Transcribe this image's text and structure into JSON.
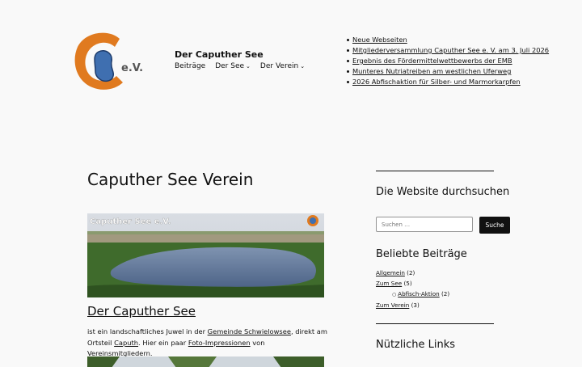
{
  "site": {
    "title": "Der Caputher See",
    "logo_text": "e.V."
  },
  "nav": [
    {
      "label": "Beiträge",
      "has_dropdown": false
    },
    {
      "label": "Der See",
      "has_dropdown": true
    },
    {
      "label": "Der Verein",
      "has_dropdown": true
    }
  ],
  "recent_posts": [
    "Neue Webseiten",
    "Mitgliederversammlung Caputher See e. V. am 3. Juli 2026",
    "Ergebnis des Fördermittelwettbewerbs der EMB",
    "Munteres Nutriatreiben am westlichen Uferweg",
    "2026 Abfischaktion für Silber- und Marmorkarpfen"
  ],
  "page_title": "Caputher See Verein",
  "post": {
    "image_caption": "Caputher See e.V.",
    "title": "Der Caputher See",
    "excerpt_1": "ist ein landschaftliches Juwel in der ",
    "link_gemeinde": "Gemeinde Schwielowsee",
    "excerpt_2": ", direkt am Ortsteil ",
    "link_caputh": "Caputh",
    "excerpt_3": ". Hier ein paar ",
    "link_foto": "Foto-Impressionen",
    "excerpt_4": " von Vereinsmitgliedern."
  },
  "sidebar": {
    "search_title": "Die Website durchsuchen",
    "search_placeholder": "Suchen …",
    "search_button": "Suche",
    "popular_title": "Beliebte Beiträge",
    "categories": [
      {
        "label": "Allgemein",
        "count": "(2)"
      },
      {
        "label": "Zum See",
        "count": "(5)"
      },
      {
        "label": "Abfisch-Aktion",
        "count": "(2)"
      },
      {
        "label": "Zum Verein",
        "count": "(3)"
      }
    ],
    "links_title": "Nützliche Links"
  },
  "colors": {
    "accent": "#e07a1f",
    "logo_blue": "#3f6fb0",
    "text": "#111111",
    "background": "#f9f9f9"
  },
  "icons": {
    "dropdown": "chevron-down-icon"
  }
}
